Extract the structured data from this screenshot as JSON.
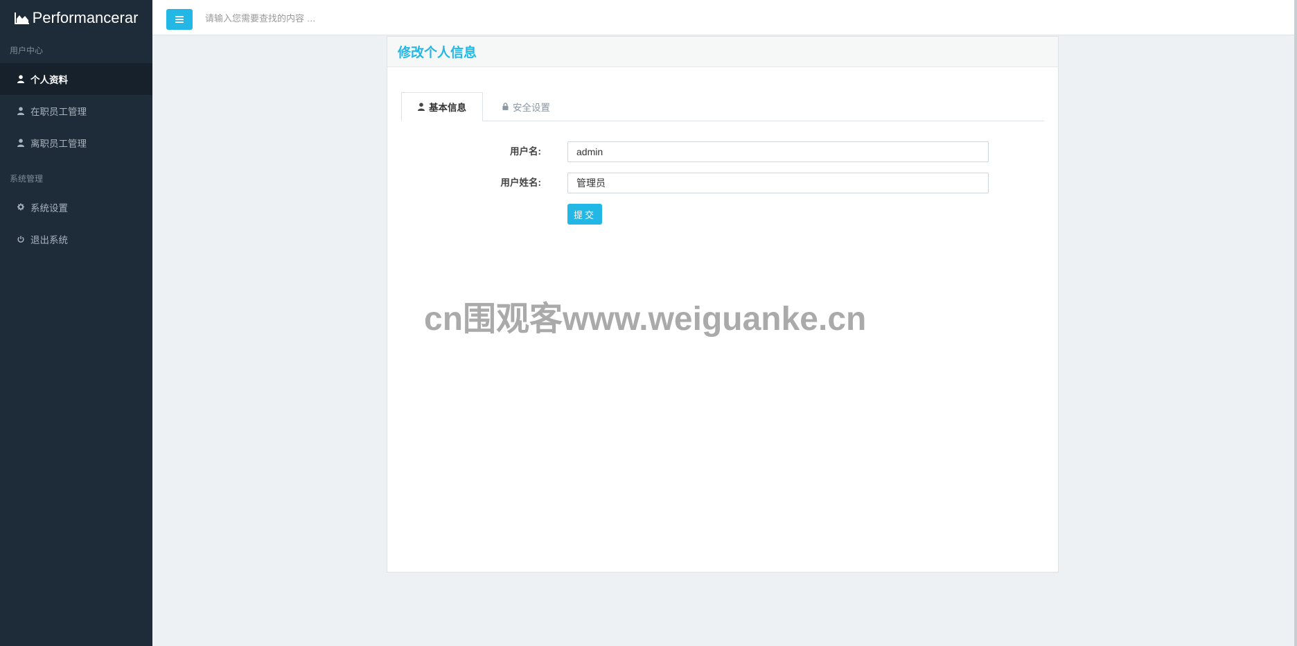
{
  "app": {
    "brand": "Performancerar",
    "brand_icon": "area-chart-icon"
  },
  "sidebar": {
    "sections": [
      {
        "title": "用户中心",
        "items": [
          {
            "label": "个人资料",
            "icon": "user-icon",
            "active": true
          },
          {
            "label": "在职员工管理",
            "icon": "user-icon",
            "active": false
          },
          {
            "label": "离职员工管理",
            "icon": "user-icon",
            "active": false
          }
        ]
      },
      {
        "title": "系统管理",
        "items": [
          {
            "label": "系统设置",
            "icon": "gear-icon",
            "active": false
          },
          {
            "label": "退出系统",
            "icon": "power-icon",
            "active": false
          }
        ]
      }
    ]
  },
  "topbar": {
    "menu_icon": "hamburger-icon",
    "search_placeholder": "请输入您需要查找的内容 …"
  },
  "panel": {
    "title": "修改个人信息",
    "tabs": [
      {
        "label": "基本信息",
        "icon": "user-icon",
        "active": true
      },
      {
        "label": "安全设置",
        "icon": "lock-icon",
        "active": false
      }
    ],
    "form": {
      "username_label": "用户名:",
      "username_value": "admin",
      "fullname_label": "用户姓名:",
      "fullname_value": "管理员",
      "submit_label": "提交"
    }
  },
  "watermark": "cn围观客www.weiguanke.cn",
  "colors": {
    "accent": "#23b7e5",
    "sidebar_bg": "#1e2b38",
    "sidebar_active_bg": "#17212b",
    "page_bg": "#eef1f3"
  }
}
